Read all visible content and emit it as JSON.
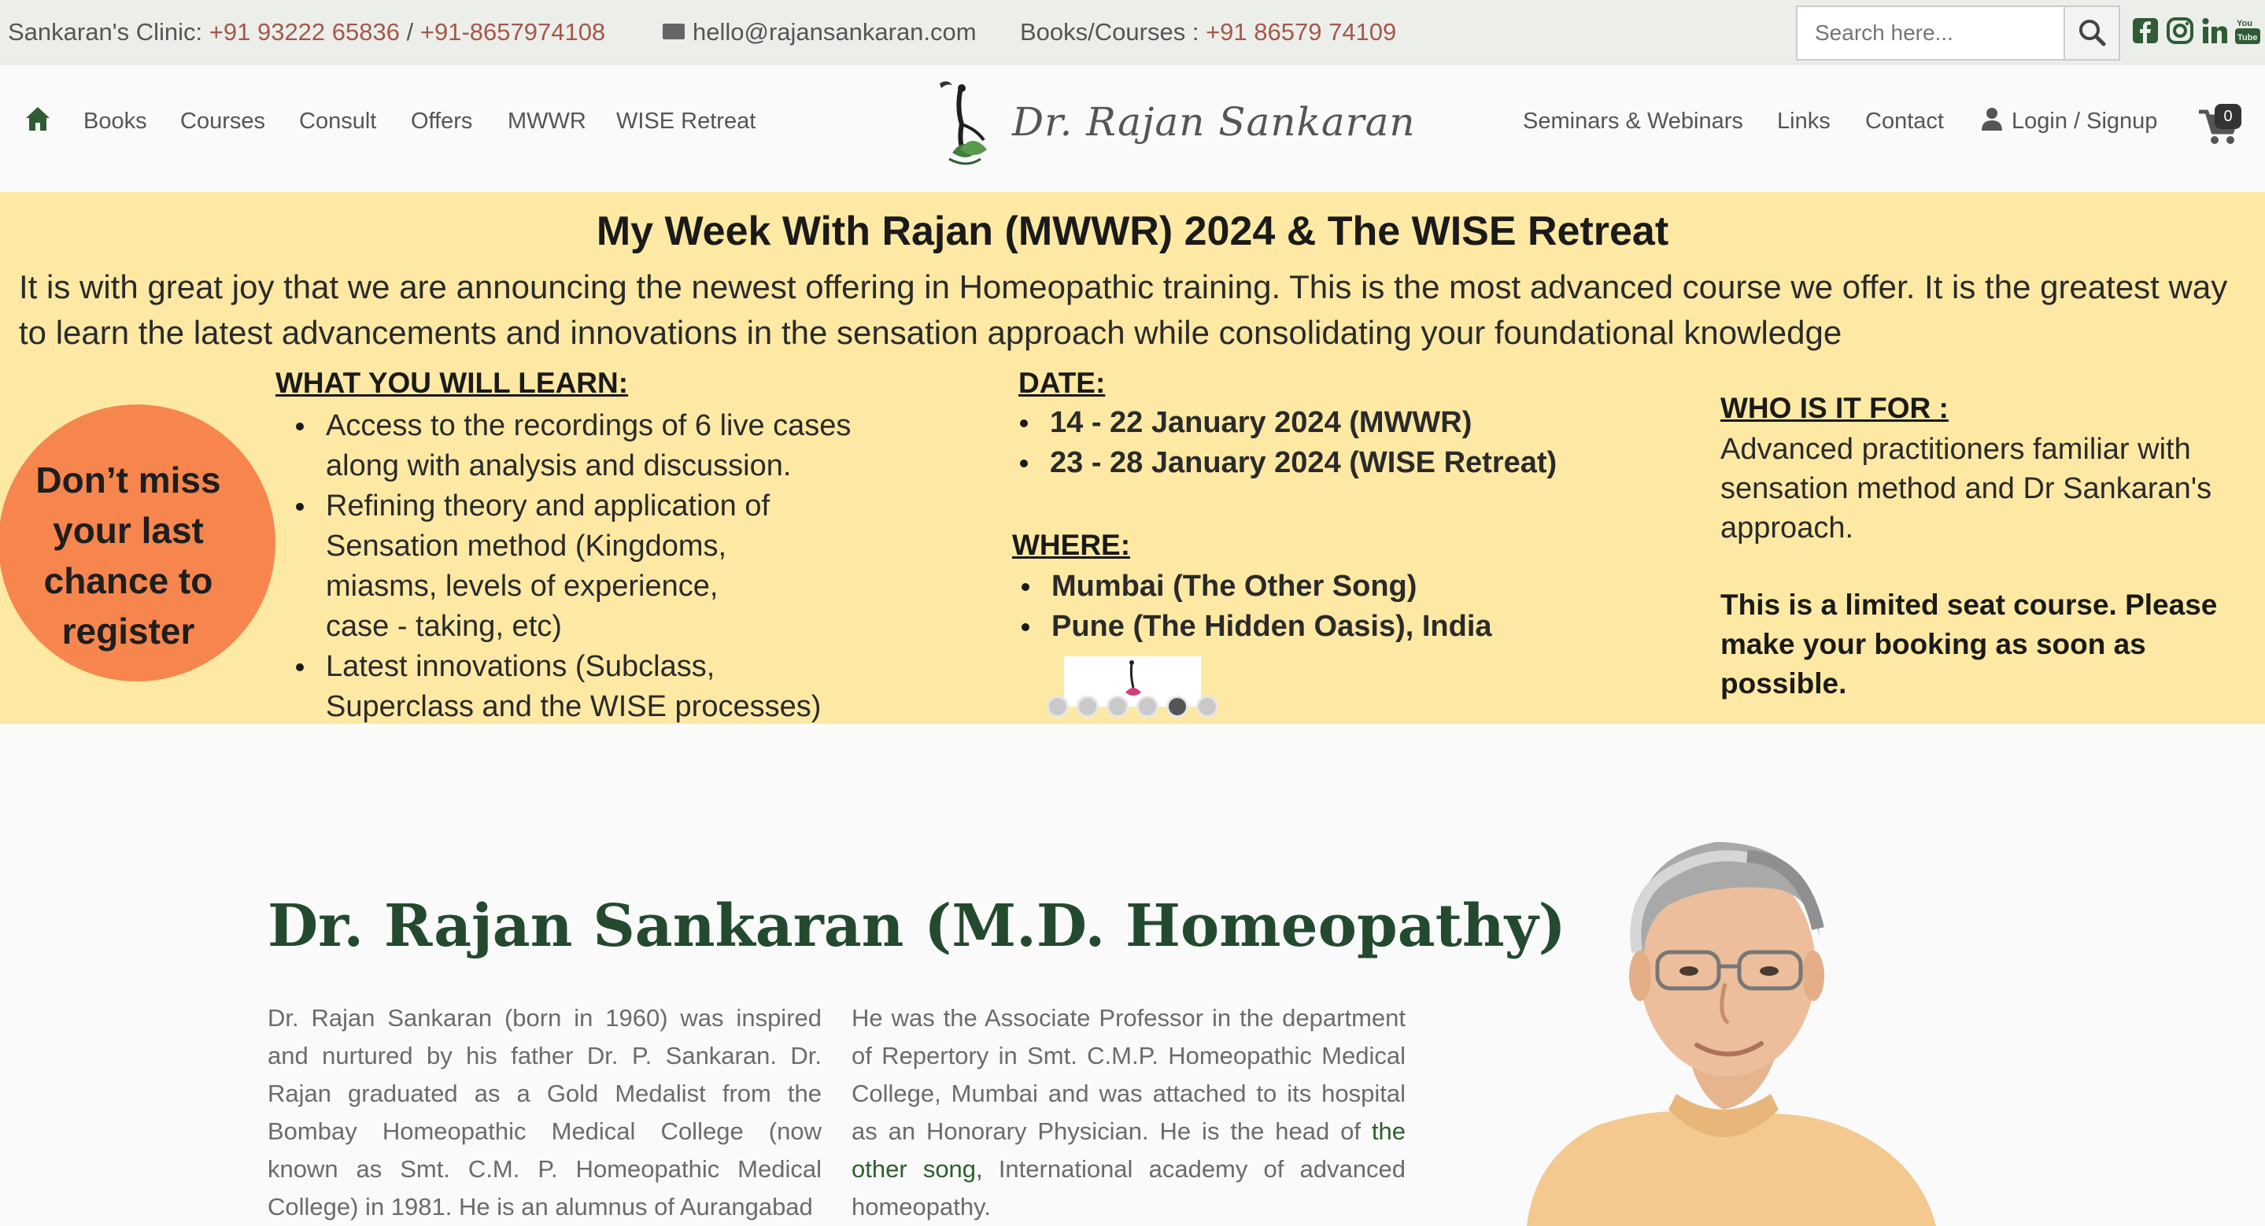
{
  "topbar": {
    "clinic_label": "Sankaran's Clinic:",
    "clinic_phone_1": "+91 93222 65836",
    "separator": "/",
    "clinic_phone_2": "+91-8657974108",
    "email": "hello@rajansankaran.com",
    "books_label": "Books/Courses :",
    "books_phone": "+91 86579 74109",
    "search_placeholder": "Search here...",
    "social_icons": [
      "facebook-icon",
      "instagram-icon",
      "linkedin-icon",
      "youtube-icon"
    ]
  },
  "nav": {
    "left_items": [
      "Books",
      "Courses",
      "Consult",
      "Offers",
      "MWWR",
      "WISE Retreat"
    ],
    "logo_text": "Dr. Rajan Sankaran",
    "right_items": [
      "Seminars & Webinars",
      "Links",
      "Contact"
    ],
    "login_label": "Login / Signup",
    "cart_count": "0"
  },
  "banner": {
    "title": "My Week With Rajan (MWWR) 2024 & The WISE Retreat",
    "intro": "It is with great joy that we are announcing the newest offering in Homeopathic training. This is the most advanced course we offer. It is the greatest way to learn the latest advancements and innovations in the sensation approach while consolidating your foundational knowledge",
    "badge": "Don’t miss your last chance to register",
    "learn_heading": "WHAT YOU WILL LEARN:",
    "learn_items": [
      "Access to the recordings of 6 live cases along with analysis and discussion.",
      "Refining theory and application of Sensation method (Kingdoms, miasms, levels of experience, case - taking, etc)",
      "Latest innovations (Subclass, Superclass and the WISE processes)"
    ],
    "date_heading": "DATE:",
    "dates": [
      "14 - 22 January 2024  (MWWR)",
      "23 - 28 January 2024 (WISE Retreat)"
    ],
    "where_heading": "WHERE:",
    "places": [
      "Mumbai (The Other Song)",
      "Pune  (The  Hidden Oasis), India"
    ],
    "who_heading": "WHO IS IT FOR :",
    "who_text": "Advanced practitioners familiar with sensation method and Dr Sankaran's approach.",
    "limited_text": "This is a limited seat course. Please make your booking as soon as possible.",
    "slide_count": 6,
    "active_slide": 5
  },
  "main": {
    "title": "Dr. Rajan Sankaran (M.D. Homeopathy)",
    "col1": "Dr. Rajan Sankaran (born in 1960) was inspired and nurtured by his father Dr. P. Sankaran. Dr. Rajan graduated as a Gold Medalist from the Bombay Homeopathic Medical College (now known as Smt. C.M. P. Homeopathic Medical College) in 1981. He is an alumnus of Aurangabad",
    "col2_before": "He was the Associate Professor in the department of Repertory in Smt. C.M.P. Homeopathic Medical College, Mumbai and was attached to its hospital as an Honorary Physician. He is the head of ",
    "col2_link": "the other song,",
    "col2_after": " International academy of advanced homeopathy."
  },
  "colors": {
    "accent_green": "#234a2f",
    "phone_red": "#a4584b",
    "banner_yellow": "#fde9a4",
    "badge_orange": "#f6864e"
  }
}
